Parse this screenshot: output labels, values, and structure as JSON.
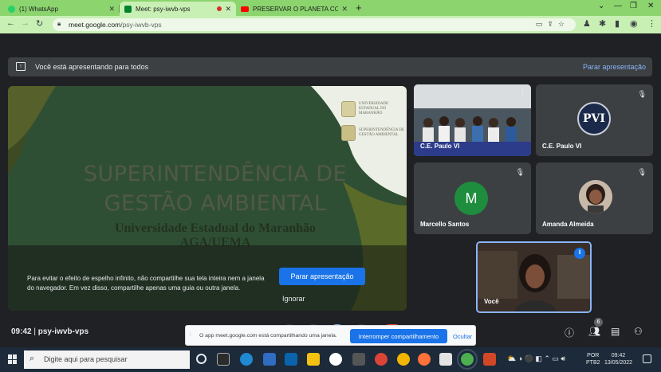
{
  "browser": {
    "tabs": [
      {
        "label": "(1) WhatsApp",
        "icon": "whatsapp-icon",
        "color": "#25d366"
      },
      {
        "label": "Meet: psy-iwvb-vps",
        "icon": "meet-icon",
        "color": "#00832d",
        "active": true
      },
      {
        "label": "PRESERVAR O PLANETA COM OS",
        "icon": "youtube-icon",
        "color": "#ff0000"
      }
    ],
    "url_host": "meet.google.com",
    "url_path": "/psy-iwvb-vps"
  },
  "meet": {
    "banner": {
      "text": "Você está apresentando para todos",
      "stop_label": "Parar apresentação"
    },
    "slide": {
      "title_line1": "SUPERINTENDÊNCIA DE",
      "title_line2": "GESTÃO AMBIENTAL",
      "subtitle_line1": "Universidade Estadual do Maranhão",
      "subtitle_line2": "AGA/UEMA",
      "logo1_text": "UNIVERSIDADE ESTADUAL DO MARANHÃO",
      "logo2_text": "SUPERINTENDÊNCIA DE GESTÃO AMBIENTAL"
    },
    "mirror_warning": {
      "text": "Para evitar o efeito de espelho infinito, não compartilhe sua tela inteira nem a janela do navegador. Em vez disso, compartilhe apenas uma guia ou outra janela.",
      "present_button": "Parar apresentação",
      "ignore_button": "Ignorar"
    },
    "participants": [
      {
        "name": "C.E. Paulo VI",
        "kind": "camera"
      },
      {
        "name": "C.E. Paulo VI",
        "kind": "logo",
        "logo_letters": "PVI"
      },
      {
        "name": "Marcello Santos",
        "kind": "initial",
        "initial": "M",
        "avatar_color": "#1e8e3e"
      },
      {
        "name": "Amanda Almeida",
        "kind": "photo"
      },
      {
        "name": "Você",
        "kind": "camera-self"
      }
    ],
    "bottom_bar": {
      "time": "09:42",
      "separator": "|",
      "meeting_code": "psy-iwvb-vps",
      "people_count": "6"
    },
    "share_notice": {
      "text": "O app meet.google.com está compartilhando uma janela.",
      "stop_label": "Interromper compartilhamento",
      "hide_label": "Ocultar"
    }
  },
  "taskbar": {
    "search_placeholder": "Digite aqui para pesquisar",
    "lang_line1": "POR",
    "lang_line2": "PTB2",
    "time": "09:42",
    "date": "13/05/2022"
  }
}
